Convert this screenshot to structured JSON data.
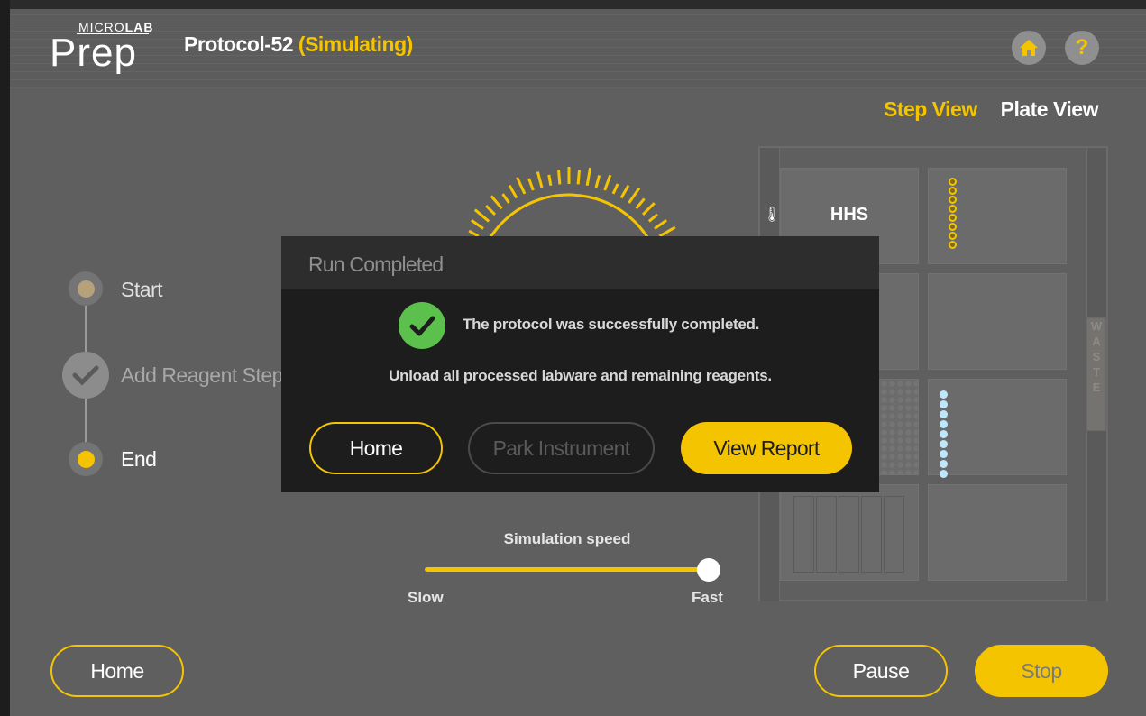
{
  "app": {
    "logo_micro": "MICRO",
    "logo_lab": "LAB",
    "logo_prep": "Prep",
    "protocol_name": "Protocol-52",
    "status": "(Simulating)"
  },
  "header_icons": [
    "home-icon",
    "help-icon"
  ],
  "help_glyph": "?",
  "view_tabs": {
    "step_view": "Step View",
    "plate_view": "Plate View",
    "active": "Step View"
  },
  "steps": [
    {
      "label": "Start",
      "state": "done"
    },
    {
      "label": "Add Reagent Step",
      "state": "completed-check"
    },
    {
      "label": "End",
      "state": "current"
    }
  ],
  "simulation": {
    "label": "Simulation speed",
    "slow_label": "Slow",
    "fast_label": "Fast",
    "speed": 1.0
  },
  "deck": {
    "hhs_label": "HHS",
    "therm_glyph": "🌡",
    "waste_letters": [
      "W",
      "A",
      "S",
      "T",
      "E"
    ]
  },
  "bottom": {
    "home_label": "Home",
    "pause_label": "Pause",
    "stop_label": "Stop"
  },
  "modal": {
    "title": "Run Completed",
    "message": "The protocol was successfully completed.",
    "instruction": "Unload all processed labware and remaining reagents.",
    "home_label": "Home",
    "park_label": "Park Instrument",
    "report_label": "View Report"
  },
  "colors": {
    "accent": "#f5c400",
    "success": "#5cc04c",
    "background": "#5f5f5f",
    "modal": "#1d1d1d"
  }
}
